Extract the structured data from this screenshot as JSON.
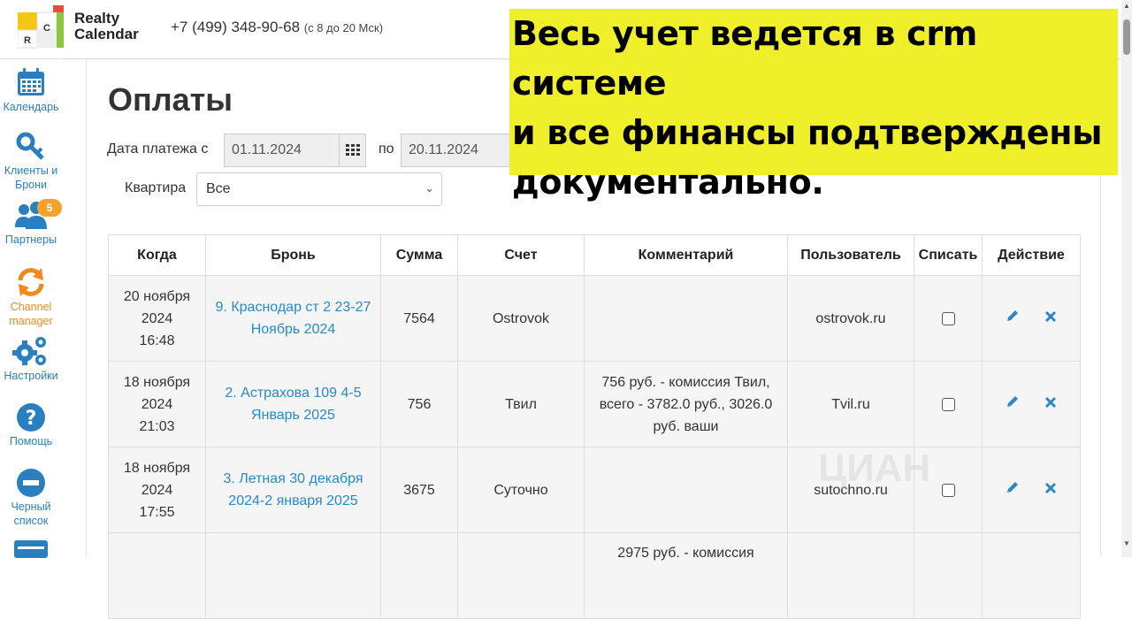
{
  "header": {
    "brand_line1": "Realty",
    "brand_line2": "Calendar",
    "phone": "+7 (499) 348-90-68",
    "hours": "(с 8 до 20 Мск)"
  },
  "logo": {
    "letters": [
      "C",
      "R"
    ]
  },
  "sidebar": {
    "items": [
      {
        "label": "Календарь",
        "icon": "calendar-icon"
      },
      {
        "label": "Клиенты и Брони",
        "icon": "key-icon"
      },
      {
        "label": "Партнеры",
        "icon": "users-icon",
        "badge": "5"
      },
      {
        "label": "Channel manager",
        "icon": "sync-icon"
      },
      {
        "label": "Настройки",
        "icon": "gears-icon"
      },
      {
        "label": "Помощь",
        "icon": "question-icon"
      },
      {
        "label": "Черный список",
        "icon": "minus-circle-icon"
      }
    ]
  },
  "page": {
    "title": "Оплаты",
    "filters": {
      "date_label": "Дата платежа с",
      "date_from": "01.11.2024",
      "to_label": "по",
      "date_to": "20.11.2024",
      "apartment_label": "Квартира",
      "apartment_value": "Все"
    }
  },
  "table": {
    "headers": [
      "Когда",
      "Бронь",
      "Сумма",
      "Счет",
      "Комментарий",
      "Пользователь",
      "Списать",
      "Действие"
    ],
    "rows": [
      {
        "when": [
          "20 ноября",
          "2024",
          "16:48"
        ],
        "booking": "9. Краснодар ст 2 23-27 Ноябрь 2024",
        "sum": "7564",
        "account": "Ostrovok",
        "comment": "",
        "user": "ostrovok.ru"
      },
      {
        "when": [
          "18 ноября",
          "2024",
          "21:03"
        ],
        "booking": "2. Астрахова 109 4-5 Январь 2025",
        "sum": "756",
        "account": "Твил",
        "comment": "756 руб. - комиссия Твил, всего - 3782.0 руб., 3026.0 руб. ваши",
        "user": "Tvil.ru"
      },
      {
        "when": [
          "18 ноября",
          "2024",
          "17:55"
        ],
        "booking": "3. Летная 30 декабря 2024-2 января 2025",
        "sum": "3675",
        "account": "Суточно",
        "comment": "",
        "user": "sutochno.ru"
      },
      {
        "when": [
          "",
          "",
          ""
        ],
        "booking": "",
        "sum": "",
        "account": "",
        "comment": "2975 руб. - комиссия",
        "user": ""
      }
    ]
  },
  "banner": {
    "lines": [
      "Весь учет ведется в crm системе",
      "и все финансы подтверждены",
      "документально."
    ],
    "color": "#f0f02a"
  },
  "watermark": "ЦИАН",
  "colors": {
    "link": "#2a88c8",
    "accent_orange": "#f6a12a"
  }
}
